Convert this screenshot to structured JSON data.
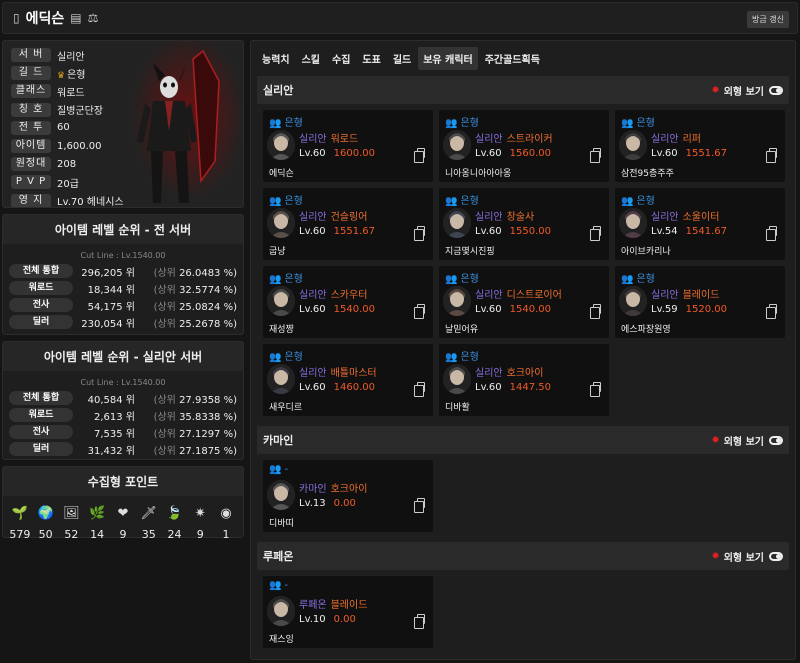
{
  "header": {
    "name": "에딕슨",
    "refresh_label": "방금 갱신"
  },
  "profile": [
    {
      "key": "서 버",
      "value": "실리안"
    },
    {
      "key": "길 드",
      "value": "은형",
      "crown": true
    },
    {
      "key": "클래스",
      "value": "워로드"
    },
    {
      "key": "칭 호",
      "value": "질병군단장"
    },
    {
      "key": "전 투",
      "value": "60"
    },
    {
      "key": "아이템",
      "value": "1,600.00"
    },
    {
      "key": "원정대",
      "value": "208"
    },
    {
      "key": "P V P",
      "value": "20급"
    },
    {
      "key": "영 지",
      "value": "Lv.70 헤네시스"
    }
  ],
  "rank_all": {
    "title": "아이템 레벨 순위 - 전 서버",
    "cutline": "Cut Line : Lv.1540.00",
    "rows": [
      {
        "key": "전체 통합",
        "rank": "296,205 위",
        "pct_label": "(상위",
        "pct": "26.0483 %)"
      },
      {
        "key": "워로드",
        "rank": "18,344 위",
        "pct_label": "(상위",
        "pct": "32.5774 %)"
      },
      {
        "key": "전사",
        "rank": "54,175 위",
        "pct_label": "(상위",
        "pct": "25.0824 %)"
      },
      {
        "key": "딜러",
        "rank": "230,054 위",
        "pct_label": "(상위",
        "pct": "25.2678 %)"
      }
    ]
  },
  "rank_server": {
    "title": "아이템 레벨 순위 - 실리안 서버",
    "cutline": "Cut Line : Lv.1540.00",
    "rows": [
      {
        "key": "전체 통합",
        "rank": "40,584 위",
        "pct_label": "(상위",
        "pct": "27.9358 %)"
      },
      {
        "key": "워로드",
        "rank": "2,613 위",
        "pct_label": "(상위",
        "pct": "35.8338 %)"
      },
      {
        "key": "전사",
        "rank": "7,535 위",
        "pct_label": "(상위",
        "pct": "27.1297 %)"
      },
      {
        "key": "딜러",
        "rank": "31,432 위",
        "pct_label": "(상위",
        "pct": "27.1875 %)"
      }
    ]
  },
  "collect": {
    "title": "수집형 포인트",
    "items": [
      {
        "icon": "seed-icon",
        "glyph": "🌱",
        "count": "579"
      },
      {
        "icon": "island-icon",
        "glyph": "🌍",
        "count": "50"
      },
      {
        "icon": "art-icon",
        "glyph": "🖼",
        "count": "52"
      },
      {
        "icon": "mokoko-icon",
        "glyph": "🌿",
        "count": "14"
      },
      {
        "icon": "heart-icon",
        "glyph": "❤",
        "count": "9"
      },
      {
        "icon": "sword-icon",
        "glyph": "🗡",
        "count": "35"
      },
      {
        "icon": "leaf-icon",
        "glyph": "🍃",
        "count": "24"
      },
      {
        "icon": "star-icon",
        "glyph": "✷",
        "count": "9"
      },
      {
        "icon": "medal-icon",
        "glyph": "◉",
        "count": "1"
      }
    ]
  },
  "tabs": [
    "능력치",
    "스킬",
    "수집",
    "도표",
    "길드",
    "보유 캐릭터",
    "주간골드획득"
  ],
  "active_tab": 5,
  "look_label": "외형 보기",
  "servers": [
    {
      "name": "실리안",
      "chars": [
        {
          "guild": "은형",
          "server": "실리안",
          "class": "워로드",
          "lv": "Lv.60",
          "il": "1600.00",
          "name": "에딕슨"
        },
        {
          "guild": "은형",
          "server": "실리안",
          "class": "스트라이커",
          "lv": "Lv.60",
          "il": "1560.00",
          "name": "니아옹니아아아옹"
        },
        {
          "guild": "은형",
          "server": "실리안",
          "class": "리퍼",
          "lv": "Lv.60",
          "il": "1551.67",
          "name": "삼전95층주주"
        },
        {
          "guild": "은형",
          "server": "실리안",
          "class": "건슬링어",
          "lv": "Lv.60",
          "il": "1551.67",
          "name": "굽냥"
        },
        {
          "guild": "은형",
          "server": "실리안",
          "class": "창술사",
          "lv": "Lv.60",
          "il": "1550.00",
          "name": "지금몇시진핑"
        },
        {
          "guild": "은형",
          "server": "실리안",
          "class": "소울이터",
          "lv": "Lv.54",
          "il": "1541.67",
          "name": "아이브카리나"
        },
        {
          "guild": "은형",
          "server": "실리안",
          "class": "스카우터",
          "lv": "Lv.60",
          "il": "1540.00",
          "name": "재성쨩"
        },
        {
          "guild": "은형",
          "server": "실리안",
          "class": "디스트로이어",
          "lv": "Lv.60",
          "il": "1540.00",
          "name": "날믿어유"
        },
        {
          "guild": "은형",
          "server": "실리안",
          "class": "블레이드",
          "lv": "Lv.59",
          "il": "1520.00",
          "name": "에스파장원영"
        },
        {
          "guild": "은형",
          "server": "실리안",
          "class": "배틀마스터",
          "lv": "Lv.60",
          "il": "1460.00",
          "name": "새우디르"
        },
        {
          "guild": "은형",
          "server": "실리안",
          "class": "호크아이",
          "lv": "Lv.60",
          "il": "1447.50",
          "name": "디바활"
        }
      ]
    },
    {
      "name": "카마인",
      "chars": [
        {
          "guild": "-",
          "server": "카마인",
          "class": "호크아이",
          "lv": "Lv.13",
          "il": "0.00",
          "name": "디바띠"
        }
      ]
    },
    {
      "name": "루페온",
      "chars": [
        {
          "guild": "-",
          "server": "루페온",
          "class": "블레이드",
          "lv": "Lv.10",
          "il": "0.00",
          "name": "재스잉"
        }
      ]
    }
  ],
  "colors": {
    "guild": "#3a8fe0",
    "server": "#8a6fe0",
    "class": "#f07030",
    "itemlevel": "#f05a2a"
  }
}
